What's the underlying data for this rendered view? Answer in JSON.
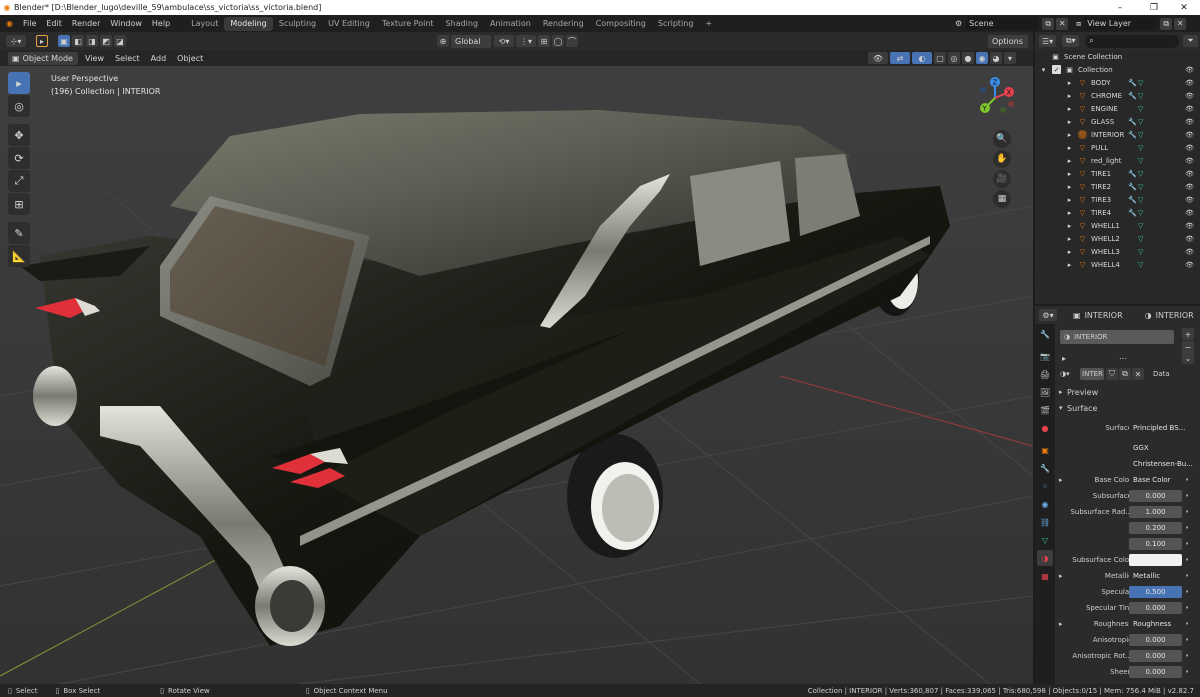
{
  "window": {
    "title": "Blender* [D:\\Blender_lugo\\deville_59\\ambulace\\ss_victoria\\ss_victoria.blend]",
    "minimize": "–",
    "maximize": "❐",
    "close": "✕"
  },
  "menu": [
    "File",
    "Edit",
    "Render",
    "Window",
    "Help"
  ],
  "workspaces": [
    "Layout",
    "Modeling",
    "Sculpting",
    "UV Editing",
    "Texture Point",
    "Shading",
    "Animation",
    "Rendering",
    "Compositing",
    "Scripting",
    "+"
  ],
  "active_workspace": "Modeling",
  "scene": {
    "label": "Scene",
    "view_layer": "View Layer"
  },
  "viewport": {
    "transform_orientation": "Global",
    "options_label": "Options",
    "mode": "Object Mode",
    "menus": [
      "View",
      "Select",
      "Add",
      "Object"
    ],
    "info_line1": "User Perspective",
    "info_line2": "(196) Collection | INTERIOR",
    "gizmo_axes": [
      "Z",
      "X",
      "Y"
    ]
  },
  "outliner": {
    "search_placeholder": "",
    "scene_collection": "Scene Collection",
    "collection": "Collection",
    "objects": [
      {
        "name": "BODY",
        "mod": true
      },
      {
        "name": "CHROME",
        "mod": true
      },
      {
        "name": "ENGINE",
        "mod": false
      },
      {
        "name": "GLASS",
        "mod": true
      },
      {
        "name": "INTERIOR",
        "mod": true,
        "selected": true
      },
      {
        "name": "PULL",
        "mod": false
      },
      {
        "name": "red_light",
        "mod": false
      },
      {
        "name": "TIRE1",
        "mod": true
      },
      {
        "name": "TIRE2",
        "mod": true
      },
      {
        "name": "TIRE3",
        "mod": true
      },
      {
        "name": "TIRE4",
        "mod": true
      },
      {
        "name": "WHELL1",
        "mod": false
      },
      {
        "name": "WHELL2",
        "mod": false
      },
      {
        "name": "WHELL3",
        "mod": false
      },
      {
        "name": "WHELL4",
        "mod": false
      }
    ]
  },
  "properties": {
    "header_object": "INTERIOR",
    "header_material": "INTERIOR",
    "slot_name": "INTERIOR",
    "material_name": "INTER",
    "data_dropdown": "Data",
    "preview_label": "Preview",
    "surface_label": "Surface",
    "surface_shader": "Principled BS...",
    "distribution": "GGX",
    "subsurface_method": "Christensen-Bu...",
    "rows": [
      {
        "label": "Base Color",
        "value": "Base Color",
        "style": "plain",
        "arrow": true
      },
      {
        "label": "Subsurface",
        "value": "0.000",
        "style": "num"
      },
      {
        "label": "Subsurface Rad...",
        "value": "1.000",
        "style": "num"
      },
      {
        "label": "",
        "value": "0.200",
        "style": "num"
      },
      {
        "label": "",
        "value": "0.100",
        "style": "num"
      },
      {
        "label": "Subsurface Color",
        "value": "",
        "style": "white"
      },
      {
        "label": "Metallic",
        "value": "Metallic",
        "style": "plain",
        "arrow": true
      },
      {
        "label": "Specular",
        "value": "0.500",
        "style": "blue"
      },
      {
        "label": "Specular Tint",
        "value": "0.000",
        "style": "num"
      },
      {
        "label": "Roughness",
        "value": "Roughness",
        "style": "plain",
        "arrow": true
      },
      {
        "label": "Anisotropic",
        "value": "0.000",
        "style": "num"
      },
      {
        "label": "Anisotropic Rot...",
        "value": "0.000",
        "style": "num"
      },
      {
        "label": "Sheen",
        "value": "0.000",
        "style": "num"
      }
    ]
  },
  "status": {
    "select": "Select",
    "box_select": "Box Select",
    "rotate_view": "Rotate View",
    "context_menu": "Object Context Menu",
    "stats": "Collection | INTERIOR | Verts:360,807 | Faces:339,065 | Tris:680,598 | Objects:0/15 | Mem: 756.4 MiB | v2.82.7"
  },
  "colors": {
    "accent": "#4772b3",
    "object_orange": "#e87d0d",
    "mesh_green": "#36c79a",
    "modifier_blue": "#6ab0ea",
    "axis_x": "#e8424e",
    "axis_y": "#7ec42b",
    "axis_z": "#3b8fe8"
  }
}
